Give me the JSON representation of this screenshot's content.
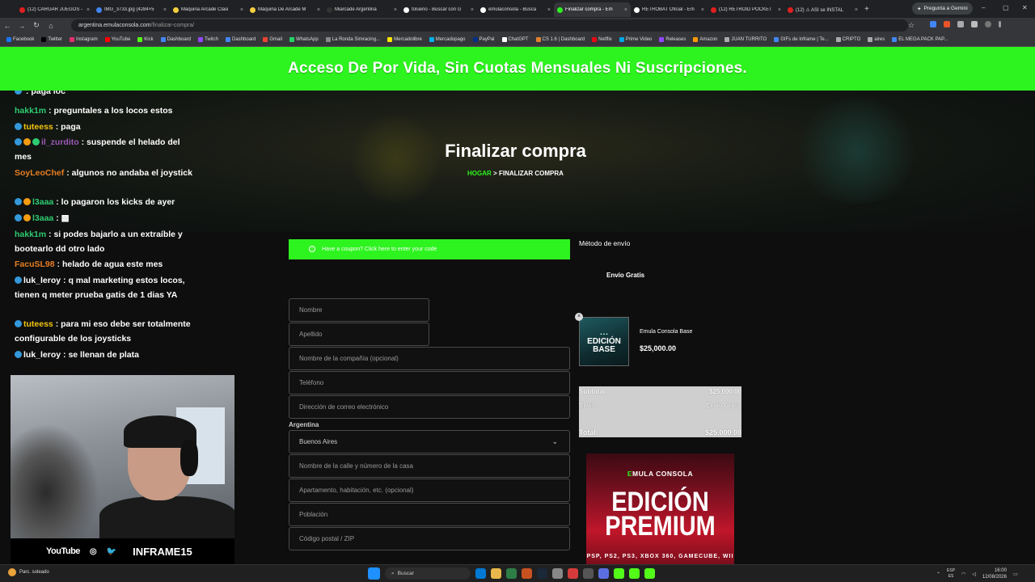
{
  "browser": {
    "tabs": [
      {
        "label": "(12) CARGAR JUEGOS -",
        "color": "#e02020",
        "active": false
      },
      {
        "label": "IMG_3733.jpg (4284×5",
        "color": "#4285f4",
        "active": false
      },
      {
        "label": "Maquina Arcade Clasi",
        "color": "#f4d03f",
        "active": false
      },
      {
        "label": "Máquina De Arcade M",
        "color": "#f4d03f",
        "active": false
      },
      {
        "label": "Miarcade Argentina",
        "color": "#333333",
        "active": false
      },
      {
        "label": "tolueno - Buscar con G",
        "color": "#ffffff",
        "active": false
      },
      {
        "label": "emulaconsola - Busca",
        "color": "#ffffff",
        "active": false
      },
      {
        "label": "Finalizar compra - Em",
        "color": "#2df31e",
        "active": true
      },
      {
        "label": "RETROBAT Oficial - Em",
        "color": "#ffffff",
        "active": false
      },
      {
        "label": "(12) RETROID POCKET",
        "color": "#e02020",
        "active": false
      },
      {
        "label": "(12) ⚠ ASI se INSTAL",
        "color": "#e02020",
        "active": false
      }
    ],
    "new_tab": "+",
    "gemini_button": "Pregunta a Gemini",
    "window_controls": {
      "minimize": "–",
      "maximize": "▢",
      "close": "✕"
    },
    "url_host": "argentina.emulaconsola.com",
    "url_path": "/finalizar-compra/",
    "bookmarks": [
      {
        "label": "Facebook",
        "color": "#1877f2"
      },
      {
        "label": "Twitter",
        "color": "#000000"
      },
      {
        "label": "Instagram",
        "color": "#e1306c"
      },
      {
        "label": "YouTube",
        "color": "#ff0000"
      },
      {
        "label": "Kick",
        "color": "#53fc18"
      },
      {
        "label": "Dashboard",
        "color": "#4285f4"
      },
      {
        "label": "Twitch",
        "color": "#9146ff"
      },
      {
        "label": "Dashboard",
        "color": "#4285f4"
      },
      {
        "label": "Gmail",
        "color": "#ea4335"
      },
      {
        "label": "WhatsApp",
        "color": "#25d366"
      },
      {
        "label": "La Ronda Simracing...",
        "color": "#888888"
      },
      {
        "label": "Mercadolibre",
        "color": "#ffe600"
      },
      {
        "label": "Mercadopago",
        "color": "#00b1ea"
      },
      {
        "label": "PayPal",
        "color": "#003087"
      },
      {
        "label": "ChatGPT",
        "color": "#ffffff"
      },
      {
        "label": "CS 1.6 | Dashboard",
        "color": "#e08030"
      },
      {
        "label": "Netflix",
        "color": "#e50914"
      },
      {
        "label": "Prime Video",
        "color": "#00a8e1"
      },
      {
        "label": "Releases",
        "color": "#9146ff"
      },
      {
        "label": "Amazon",
        "color": "#ff9900"
      },
      {
        "label": "JUAN TURRITO",
        "color": "#aaaaaa"
      },
      {
        "label": "GIFs de Inframe | Te...",
        "color": "#4285f4"
      },
      {
        "label": "CRIPTO",
        "color": "#aaaaaa"
      },
      {
        "label": "aires",
        "color": "#aaaaaa"
      },
      {
        "label": "EL MEGA PACK PAP...",
        "color": "#4285f4"
      }
    ]
  },
  "site": {
    "accent": "#2df31e",
    "banner": "Acceso De Por Vida, Sin Cuotas Mensuales Ni Suscripciones.",
    "page_title": "Finalizar compra",
    "breadcrumb_home": "HOGAR",
    "breadcrumb_sep": ">",
    "breadcrumb_current": "FINALIZAR COMPRA",
    "coupon_text": "Have a coupon? Click here to enter your code",
    "form": {
      "nombre": "Nombre",
      "apellido": "Apellido",
      "compania": "Nombre de la compañía (opcional)",
      "telefono": "Teléfono",
      "email": "Dirección de correo electrónico",
      "country": "Argentina",
      "province": "Buenos Aires",
      "calle": "Nombre de la calle y número de la casa",
      "apartamento": "Apartamento, habitación, etc. (opcional)",
      "poblacion": "Población",
      "postal": "Código postal / ZIP"
    },
    "shipping_title": "Método de envío",
    "shipping_option": "Envío Gratis",
    "product": {
      "name": "Emula Consola Base",
      "price": "$25,000.00",
      "image_line1": "EDICIÓN",
      "image_line2": "BASE"
    },
    "totals": {
      "subtotal_label": "Subtotal",
      "subtotal_value": "$25,000.00",
      "envio_label": "Envío",
      "envio_value": "Envío Gratis",
      "total_label": "Total",
      "total_value": "$25,000.00"
    },
    "promo": {
      "brand_prefix": "E",
      "brand_rest": "MULA CONSOLA",
      "line1": "EDICIÓN",
      "line2": "PREMIUM",
      "platforms": "PSP, PS2, PS3, XBOX 360, GAMECUBE, WII"
    }
  },
  "chat": [
    {
      "user": "",
      "text": ": paga loc",
      "color": "#f1c40f",
      "badges": [
        "#3498db"
      ]
    },
    {
      "user": "hakk1m",
      "text": ": preguntales a los locos estos",
      "color": "#2ecc71",
      "badges": []
    },
    {
      "user": "tuteess",
      "text": ": paga",
      "color": "#f1c40f",
      "badges": [
        "#3498db"
      ]
    },
    {
      "user": "il_zurdito",
      "text": ": suspende el helado del mes",
      "color": "#9b59b6",
      "badges": [
        "#3498db",
        "#f39c12",
        "#2ecc71"
      ]
    },
    {
      "user": "SoyLeoChef",
      "text": ": algunos no andaba el joystick",
      "color": "#e67e22",
      "badges": []
    },
    {
      "user": "l3aaa",
      "text": ": lo pagaron los kicks de ayer",
      "color": "#2ecc71",
      "badges": [
        "#3498db",
        "#f39c12"
      ]
    },
    {
      "user": "l3aaa",
      "text": ": ▩",
      "color": "#2ecc71",
      "badges": [
        "#3498db",
        "#f39c12"
      ]
    },
    {
      "user": "hakk1m",
      "text": ": si podes bajarlo a un extraíble y bootearlo dd otro lado",
      "color": "#2ecc71",
      "badges": []
    },
    {
      "user": "FacuSL98",
      "text": ": helado de agua este mes",
      "color": "#e67e22",
      "badges": []
    },
    {
      "user": "luk_leroy",
      "text": ": q mal marketing estos locos, tienen q meter prueba gatis de 1 dias YA",
      "color": "#ffffff",
      "badges": [
        "#3498db"
      ]
    },
    {
      "user": "tuteess",
      "text": ": para mi eso debe ser totalmente configurable de los joysticks",
      "color": "#f1c40f",
      "badges": [
        "#3498db"
      ]
    },
    {
      "user": "luk_leroy",
      "text": ": se llenan de plata",
      "color": "#ffffff",
      "badges": [
        "#3498db"
      ]
    }
  ],
  "overlay": {
    "youtube": "YouTube",
    "instagram_icon": "◎",
    "twitter_icon": "🐦",
    "name": "INFRAME15"
  },
  "taskbar": {
    "weather": "Parc. soleado",
    "search": "Buscar",
    "lang_top": "ESP",
    "lang_bottom": "ES",
    "time": "16:00",
    "date": "12/08/2026",
    "pinned": [
      "#0078d4",
      "#e8b84a",
      "#2d7d46",
      "#c7511f",
      "#1b2838",
      "#888888",
      "#d63b3b",
      "#555555",
      "#5b6ee1",
      "#53fc18",
      "#53fc18",
      "#53fc18"
    ]
  }
}
